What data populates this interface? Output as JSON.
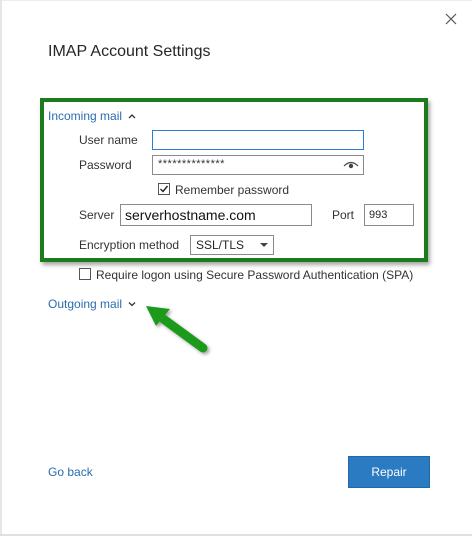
{
  "dialog": {
    "title": "IMAP Account Settings"
  },
  "incoming": {
    "section_label": "Incoming mail",
    "username_label": "User name",
    "username_value": "",
    "password_label": "Password",
    "password_masked": "**************",
    "remember_label": "Remember password",
    "remember_checked": true,
    "server_label": "Server",
    "server_value": "serverhostname.com",
    "port_label": "Port",
    "port_value": "993",
    "encryption_label": "Encryption method",
    "encryption_value": "SSL/TLS",
    "spa_label": "Require logon using Secure Password Authentication (SPA)",
    "spa_checked": false
  },
  "outgoing": {
    "section_label": "Outgoing mail"
  },
  "footer": {
    "back_label": "Go back",
    "repair_label": "Repair"
  },
  "colors": {
    "accent": "#2a7bc1",
    "link": "#2b6cb0",
    "highlight": "#1d7a1d"
  },
  "icons": {
    "close": "close-icon",
    "chevron_up": "chevron-up-icon",
    "chevron_down": "chevron-down-icon",
    "eye": "eye-icon",
    "check": "checkmark-icon",
    "arrow": "arrow-pointer-icon"
  }
}
